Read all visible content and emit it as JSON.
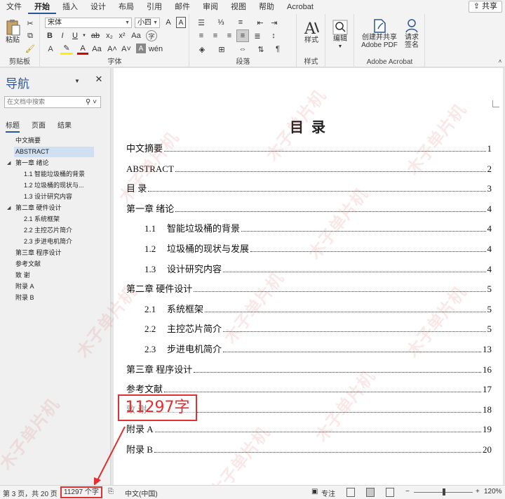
{
  "ribbon": {
    "tabs": [
      "文件",
      "开始",
      "插入",
      "设计",
      "布局",
      "引用",
      "邮件",
      "审阅",
      "视图",
      "帮助",
      "Acrobat"
    ],
    "active_tab": "开始",
    "share_label": "共享",
    "clipboard": {
      "paste": "粘贴",
      "label": "剪贴板"
    },
    "font": {
      "name": "宋体",
      "size": "小四",
      "label": "字体"
    },
    "paragraph": {
      "label": "段落"
    },
    "styles": {
      "button": "样式",
      "label": "样式"
    },
    "editing": {
      "button": "编辑"
    },
    "acrobat": {
      "create_share": "创建并共享\nAdobe PDF",
      "request_sign": "请求\n签名",
      "label": "Adobe Acrobat"
    }
  },
  "nav": {
    "title": "导航",
    "search_placeholder": "在文档中搜索",
    "tabs": [
      "标题",
      "页面",
      "结果"
    ],
    "active_tab": "标题",
    "headings": [
      {
        "text": "中文摘要",
        "level": 1
      },
      {
        "text": "ABSTRACT",
        "level": 1,
        "selected": true
      },
      {
        "text": "第一章  绪论",
        "level": 1,
        "expanded": true
      },
      {
        "text": "1.1  智能垃圾桶的背景",
        "level": 2
      },
      {
        "text": "1.2  垃圾桶的现状与...",
        "level": 2
      },
      {
        "text": "1.3  设计研究内容",
        "level": 2
      },
      {
        "text": "第二章  硬件设计",
        "level": 1,
        "expanded": true
      },
      {
        "text": "2.1  系统框架",
        "level": 2
      },
      {
        "text": "2.2  主控芯片简介",
        "level": 2
      },
      {
        "text": "2.3  步进电机简介",
        "level": 2
      },
      {
        "text": "第三章  程序设计",
        "level": 1
      },
      {
        "text": "参考文献",
        "level": 1
      },
      {
        "text": "致  谢",
        "level": 1
      },
      {
        "text": "附录 A",
        "level": 1
      },
      {
        "text": "附录 B",
        "level": 1
      }
    ]
  },
  "document": {
    "title": "目  录",
    "toc": [
      {
        "num": "",
        "text": "中文摘要",
        "page": "1",
        "level": 1
      },
      {
        "num": "",
        "text": "ABSTRACT",
        "page": "2",
        "level": 1
      },
      {
        "num": "",
        "text": "目  录",
        "page": "3",
        "level": 1
      },
      {
        "num": "",
        "text": "第一章  绪论",
        "page": "4",
        "level": 1
      },
      {
        "num": "1.1",
        "text": "智能垃圾桶的背景",
        "page": "4",
        "level": 2
      },
      {
        "num": "1.2",
        "text": "垃圾桶的现状与发展",
        "page": "4",
        "level": 2
      },
      {
        "num": "1.3",
        "text": "设计研究内容",
        "page": "4",
        "level": 2
      },
      {
        "num": "",
        "text": "第二章   硬件设计",
        "page": "5",
        "level": 1
      },
      {
        "num": "2.1",
        "text": "系统框架",
        "page": "5",
        "level": 2
      },
      {
        "num": "2.2",
        "text": "主控芯片简介",
        "page": "5",
        "level": 2
      },
      {
        "num": "2.3",
        "text": "步进电机简介",
        "page": "13",
        "level": 2
      },
      {
        "num": "",
        "text": "第三章   程序设计",
        "page": "16",
        "level": 1
      },
      {
        "num": "",
        "text": "参考文献",
        "page": "17",
        "level": 1
      },
      {
        "num": "",
        "text": "致  谢",
        "page": "18",
        "level": 1
      },
      {
        "num": "",
        "text": "附录  A",
        "page": "19",
        "level": 1
      },
      {
        "num": "",
        "text": "附录  B",
        "page": "20",
        "level": 1
      }
    ]
  },
  "annotation": {
    "text": "11297字"
  },
  "watermark": "木子单片机",
  "status": {
    "page_info": "第 3 页，共 20 页",
    "word_count": "11297 个字",
    "language": "中文(中国)",
    "focus": "专注",
    "zoom": "120%"
  }
}
